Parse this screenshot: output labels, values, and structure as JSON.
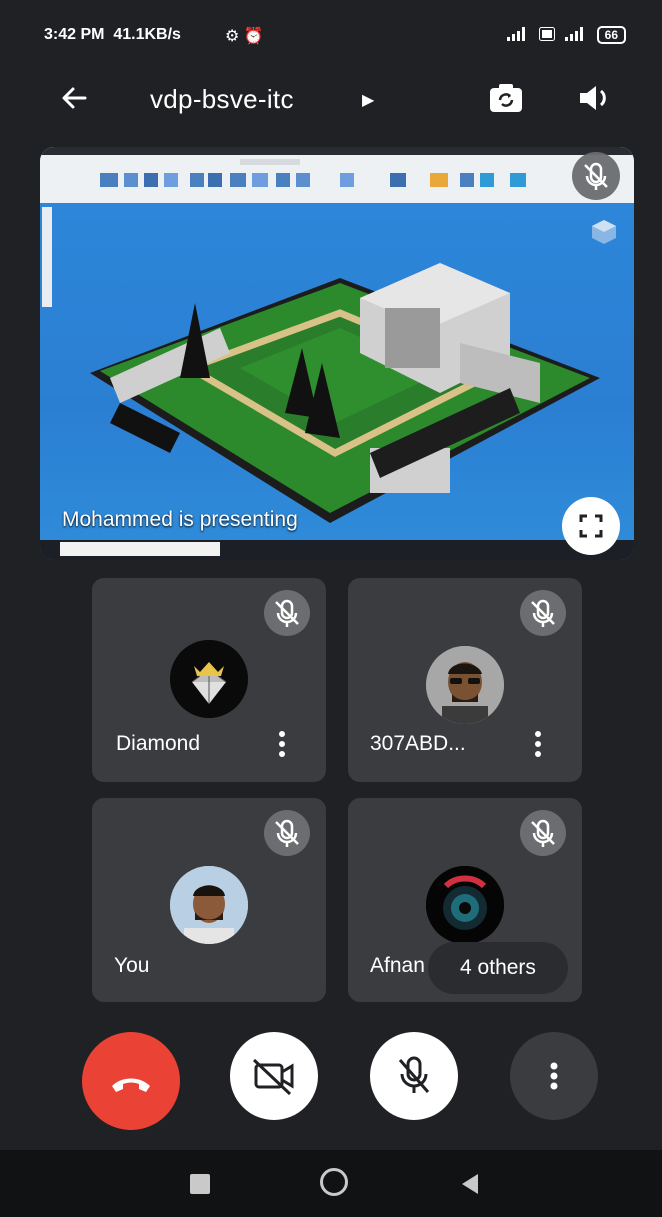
{
  "status_bar": {
    "time": "3:42 PM",
    "network_speed": "41.1KB/s",
    "battery": "66"
  },
  "header": {
    "meeting_code": "vdp-bsve-itc"
  },
  "presentation": {
    "label": "Mohammed is presenting"
  },
  "participants": [
    {
      "name": "Diamond",
      "muted": true
    },
    {
      "name": "307ABD...",
      "muted": true
    },
    {
      "name": "You",
      "muted": true
    },
    {
      "name": "Afnan",
      "muted": true
    }
  ],
  "others_pill": "4 others",
  "colors": {
    "end_call": "#ea4335",
    "tile_bg": "#3b3c40",
    "background": "#202124"
  }
}
